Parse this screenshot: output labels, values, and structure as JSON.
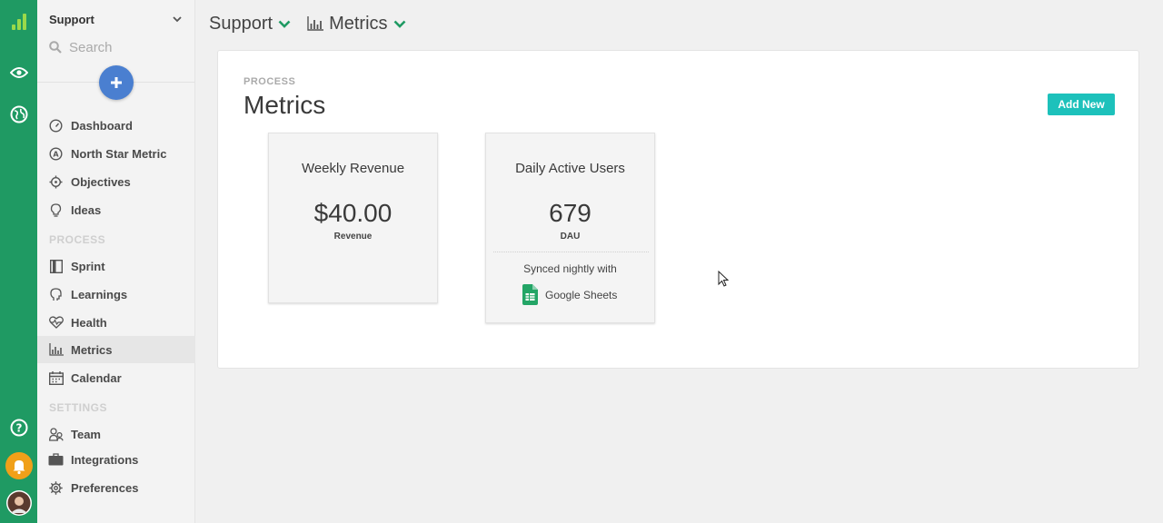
{
  "sidebar": {
    "workspace": "Support",
    "search_placeholder": "Search",
    "items": [
      {
        "label": "Dashboard"
      },
      {
        "label": "North Star Metric"
      },
      {
        "label": "Objectives"
      },
      {
        "label": "Ideas"
      }
    ],
    "process_label": "PROCESS",
    "process_items": [
      {
        "label": "Sprint"
      },
      {
        "label": "Learnings"
      },
      {
        "label": "Health"
      },
      {
        "label": "Metrics"
      },
      {
        "label": "Calendar"
      }
    ],
    "settings_label": "SETTINGS",
    "settings_items": [
      {
        "label": "Team"
      },
      {
        "label": "Integrations"
      },
      {
        "label": "Preferences"
      }
    ]
  },
  "topbar": {
    "workspace": "Support",
    "page": "Metrics"
  },
  "main": {
    "eyebrow": "PROCESS",
    "title": "Metrics",
    "add_button": "Add New",
    "cards": [
      {
        "name": "Weekly Revenue",
        "value": "$40.00",
        "unit": "Revenue"
      },
      {
        "name": "Daily Active Users",
        "value": "679",
        "unit": "DAU",
        "sync_text": "Synced nightly with",
        "sync_source": "Google Sheets"
      }
    ]
  },
  "colors": {
    "rail": "#1f9a63",
    "accent": "#1dc1bb",
    "plus": "#4a7fd0",
    "bell": "#f0a019"
  },
  "icons": [
    "logo-bars-icon",
    "eye-icon",
    "globe-icon",
    "help-icon",
    "bell-icon",
    "avatar",
    "search-icon",
    "chart-icon",
    "google-sheets-icon"
  ]
}
